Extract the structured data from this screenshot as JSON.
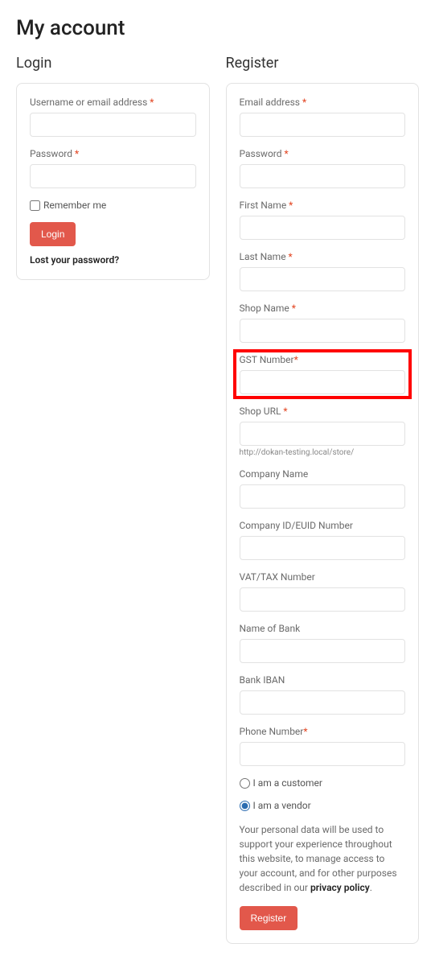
{
  "page": {
    "title": "My account"
  },
  "login": {
    "heading": "Login",
    "username_label": "Username or email address ",
    "password_label": "Password ",
    "remember_label": "Remember me",
    "submit_label": "Login",
    "lost_password_label": "Lost your password?"
  },
  "register": {
    "heading": "Register",
    "email_label": "Email address ",
    "password_label": "Password ",
    "first_name_label": "First Name ",
    "last_name_label": "Last Name ",
    "shop_name_label": "Shop Name ",
    "gst_label": "GST Number",
    "shop_url_label": "Shop URL ",
    "shop_url_helper": "http://dokan-testing.local/store/",
    "company_name_label": "Company Name",
    "company_id_label": "Company ID/EUID Number",
    "vat_label": "VAT/TAX Number",
    "bank_name_label": "Name of Bank",
    "bank_iban_label": "Bank IBAN",
    "phone_label": "Phone Number",
    "role_customer_label": "I am a customer",
    "role_vendor_label": "I am a vendor",
    "role_selected": "vendor",
    "privacy_text": "Your personal data will be used to support your experience throughout this website, to manage access to your account, and for other purposes described in our ",
    "privacy_link_text": "privacy policy",
    "privacy_suffix": ".",
    "submit_label": "Register"
  },
  "required_marker": "*"
}
